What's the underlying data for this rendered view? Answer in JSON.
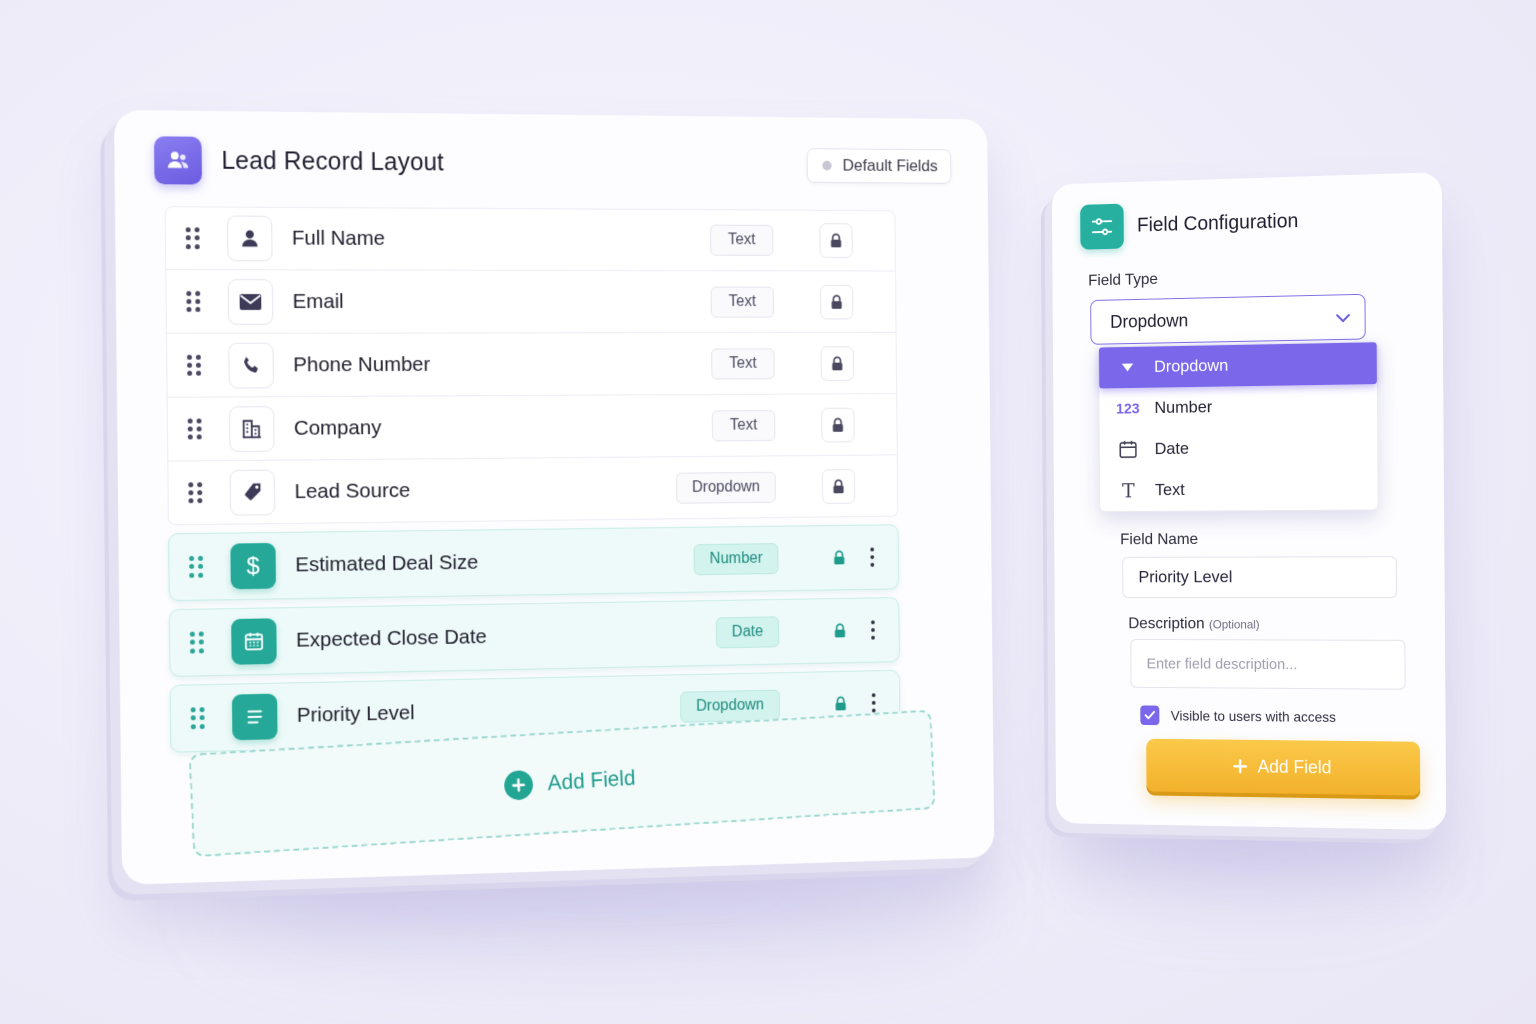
{
  "layout_panel": {
    "title": "Lead Record Layout",
    "default_chip": "Default Fields",
    "rows": [
      {
        "label": "Full Name",
        "type": "Text",
        "icon": "person-icon",
        "kind": "default"
      },
      {
        "label": "Email",
        "type": "Text",
        "icon": "envelope-icon",
        "kind": "default"
      },
      {
        "label": "Phone Number",
        "type": "Text",
        "icon": "phone-icon",
        "kind": "default"
      },
      {
        "label": "Company",
        "type": "Text",
        "icon": "building-icon",
        "kind": "default"
      },
      {
        "label": "Lead Source",
        "type": "Dropdown",
        "icon": "tag-icon",
        "kind": "default"
      },
      {
        "label": "Estimated Deal Size",
        "type": "Number",
        "icon": "dollar-icon",
        "kind": "custom"
      },
      {
        "label": "Expected Close Date",
        "type": "Date",
        "icon": "calendar-icon",
        "kind": "custom"
      },
      {
        "label": "Priority Level",
        "type": "Dropdown",
        "icon": "list-icon",
        "kind": "custom"
      }
    ],
    "add_field_label": "Add Field"
  },
  "config_panel": {
    "title": "Field Configuration",
    "field_type_label": "Field Type",
    "selected_type": "Dropdown",
    "type_options": [
      {
        "label": "Dropdown",
        "icon": "caret-down-icon",
        "selected": true
      },
      {
        "label": "Number",
        "icon": "number-icon",
        "glyph": "123",
        "selected": false
      },
      {
        "label": "Date",
        "icon": "calendar-icon",
        "selected": false
      },
      {
        "label": "Text",
        "icon": "text-icon",
        "glyph": "T",
        "selected": false
      }
    ],
    "field_name_label": "Field Name",
    "field_name_value": "Priority Level",
    "description_label": "Description",
    "description_optional": "(Optional)",
    "description_placeholder": "Enter field description...",
    "visibility_label": "Visible to users with access",
    "visibility_checked": true,
    "add_button_label": "Add Field"
  },
  "colors": {
    "accent_purple": "#7a67ea",
    "accent_teal": "#25a898",
    "accent_yellow": "#f2b12b"
  }
}
